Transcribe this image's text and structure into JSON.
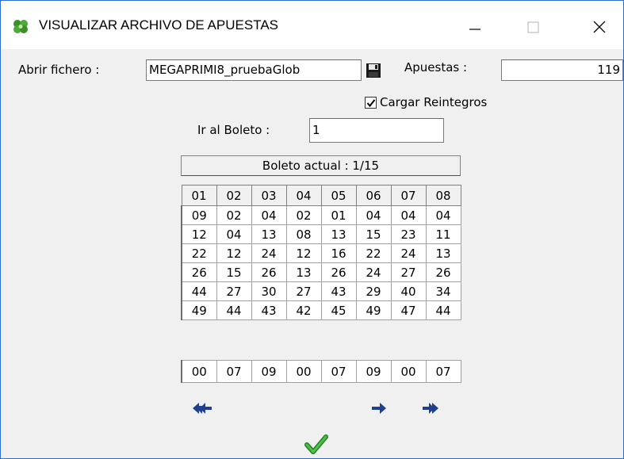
{
  "window": {
    "title": "VISUALIZAR ARCHIVO DE APUESTAS",
    "icon": "clover-icon",
    "controls": [
      "minimize-icon",
      "maximize-icon",
      "close-icon"
    ]
  },
  "file": {
    "label": "Abrir fichero :",
    "value": "MEGAPRIMI8_pruebaGlob",
    "save_icon": "floppy-disk-icon"
  },
  "apuestas": {
    "label": "Apuestas :",
    "value": "119"
  },
  "reintegros": {
    "label": "Cargar Reintegros",
    "checked": true
  },
  "boleto": {
    "label": "Ir al Boleto :",
    "value": "1"
  },
  "current": {
    "text": "Boleto actual : 1/15"
  },
  "grid": {
    "columns": [
      "01",
      "02",
      "03",
      "04",
      "05",
      "06",
      "07",
      "08"
    ],
    "rows": [
      [
        "09",
        "02",
        "04",
        "02",
        "01",
        "04",
        "04",
        "04"
      ],
      [
        "12",
        "04",
        "13",
        "08",
        "13",
        "15",
        "23",
        "11"
      ],
      [
        "22",
        "12",
        "24",
        "12",
        "16",
        "22",
        "24",
        "13"
      ],
      [
        "26",
        "15",
        "26",
        "13",
        "26",
        "24",
        "27",
        "26"
      ],
      [
        "44",
        "27",
        "30",
        "27",
        "43",
        "29",
        "40",
        "34"
      ],
      [
        "49",
        "44",
        "43",
        "42",
        "45",
        "49",
        "47",
        "44"
      ]
    ]
  },
  "reintegro_values": [
    "00",
    "07",
    "09",
    "00",
    "07",
    "09",
    "00",
    "07"
  ],
  "navigation": {
    "first_icon": "double-arrow-left-icon",
    "next_icon": "arrow-right-icon",
    "last_icon": "double-arrow-right-icon",
    "ok_icon": "checkmark-icon"
  },
  "colors": {
    "window_border": "#2b6fd6",
    "nav_arrow": "#1f3f8f",
    "checkmark": "#2aa52a"
  }
}
